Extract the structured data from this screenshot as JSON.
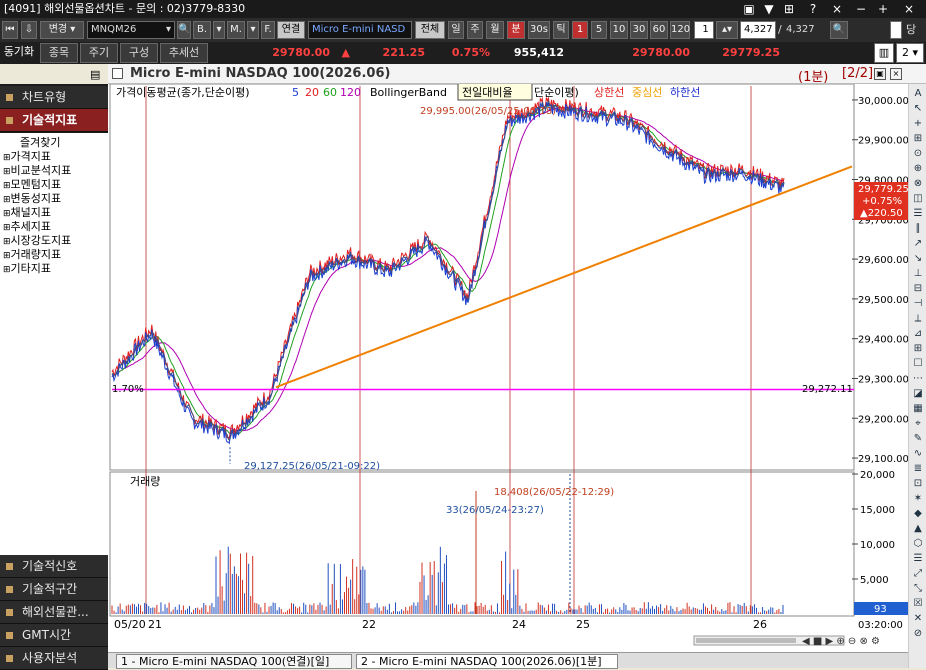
{
  "window": {
    "title": "[4091] 해외선물옵션차트 - 문의 : 02)3779-8330",
    "app_icon": "2"
  },
  "toolbar1": {
    "change_label": "변경",
    "symbol": "MNQM26",
    "btn_b": "B.",
    "btn_m": "M.",
    "btn_f": "F.",
    "link_label": "연결",
    "symbol_name": "Micro E-mini NASD",
    "period_all": "전체",
    "period_day": "일",
    "period_week": "주",
    "period_month": "월",
    "period_min": "분",
    "period_30s": "30s",
    "period_tick": "틱",
    "n1": "1",
    "n5": "5",
    "n10": "10",
    "n30": "30",
    "n60": "60",
    "n120": "120",
    "interval": "1",
    "count1": "4,327",
    "count2": "4,327",
    "right_label": "당일"
  },
  "toolbar2": {
    "sync_label": "동기화",
    "tab_item": "종목",
    "tab_period": "주기",
    "tab_compose": "구성",
    "tab_trend": "추세선",
    "price": "29780.00",
    "arrow": "▲",
    "change": "221.25",
    "rate": "0.75%",
    "volume": "955,412",
    "high": "29780.00",
    "low": "29779.25",
    "pages": "2"
  },
  "sidebar": {
    "chart_type": "차트유형",
    "tech_indicator": "기술적지표",
    "tree": [
      "즐겨찾기",
      "가격지표",
      "비교분석지표",
      "모멘텀지표",
      "변동성지표",
      "채널지표",
      "추세지표",
      "시장강도지표",
      "거래량지표",
      "기타지표"
    ],
    "bottom": [
      "기술적신호",
      "기술적구간",
      "해외선물관...",
      "GMT시간",
      "사용자분석"
    ]
  },
  "chart": {
    "title": "Micro E-mini NASDAQ 100(2026.06)",
    "period": "(1분)",
    "page": "[2/2]",
    "ma_label": "가격이동평균(종가,단순이평)",
    "ma_periods": [
      "5",
      "20",
      "60",
      "120"
    ],
    "bb_label": "BollingerBand",
    "bb_tooltip": "전일대비율",
    "bb_param": "단순이평)",
    "bb_upper": "상한선",
    "bb_mid": "중심선",
    "bb_lower": "하한선",
    "high_note": "29,995.00(26/05/25-00:18)",
    "low_note": "29,127.25(26/05/21-09:22)",
    "hline_value": "29,272.11",
    "hline_pct": "1.70%",
    "current_price": "29,779.25",
    "current_rate": "+0.75%",
    "current_change": "▲220.50",
    "volume_label": "거래량",
    "vol_high_note": "18,408(26/05/22-12:29)",
    "vol_low_note": "33(26/05/24-23:27)",
    "vol_current": "93",
    "price_axis": [
      "30,000.00",
      "29,900.00",
      "29,800.00",
      "29,700.00",
      "29,600.00",
      "29,500.00",
      "29,400.00",
      "29,300.00",
      "29,200.00",
      "29,100.00"
    ],
    "vol_axis": [
      "20,000",
      "15,000",
      "10,000",
      "5,000"
    ],
    "x_labels": [
      "05/20",
      "21",
      "22",
      "24",
      "25",
      "26"
    ],
    "time_label": "03:20:00"
  },
  "chart_data": {
    "type": "line",
    "title": "Micro E-mini NASDAQ 100(2026.06)",
    "x": [
      "05/20",
      "21",
      "22",
      "24",
      "25",
      "26"
    ],
    "ylim": [
      29080,
      30030
    ],
    "series": [
      {
        "name": "가격",
        "values": [
          29310,
          29420,
          29200,
          29160,
          29260,
          29560,
          29610,
          29570,
          29650,
          29500,
          29950,
          29985,
          29970,
          29950,
          29880,
          29815,
          29820,
          29780
        ]
      }
    ],
    "trendline": {
      "from": [
        29278,
        "05/21"
      ],
      "to": [
        29830,
        "26"
      ]
    },
    "hline": 29272.11,
    "volume_ylim": [
      0,
      20000
    ]
  },
  "tabs": [
    "1 - Micro E-mini NASDAQ 100(연결)[일]",
    "2 - Micro E-mini NASDAQ 100(2026.06)[1분]"
  ],
  "colors": {
    "ma5": "#1a3fd0",
    "ma20": "#e02020",
    "ma60": "#20a020",
    "ma120": "#b000b0",
    "trend": "#f08000",
    "hline": "#ff00ff",
    "vol_up": "#d03020",
    "vol_dn": "#2050c0"
  }
}
